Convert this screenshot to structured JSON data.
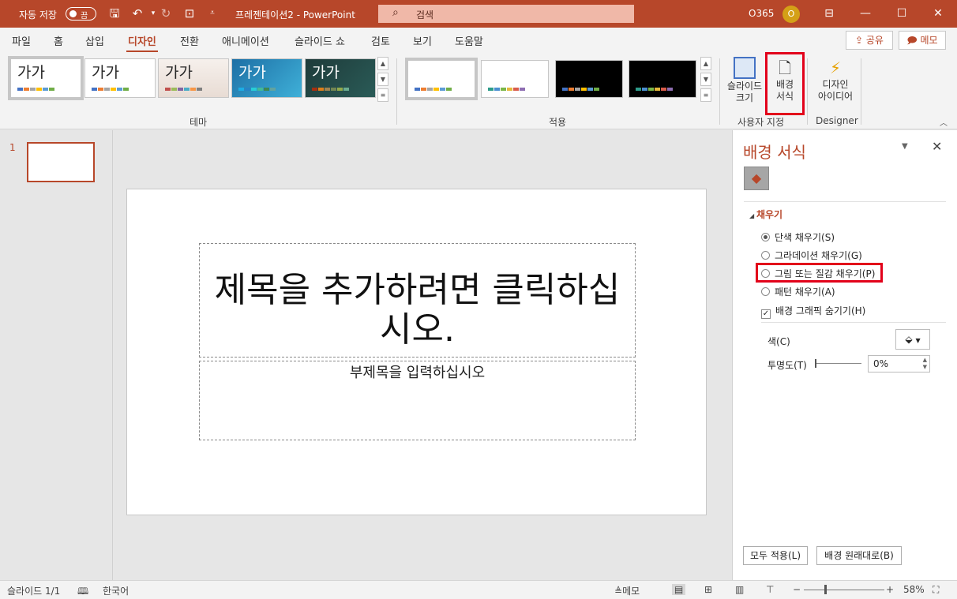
{
  "titlebar": {
    "autosave_label": "자동 저장",
    "autosave_state": "끔",
    "doc_title": "프레젠테이션2 - PowerPoint",
    "search_placeholder": "검색",
    "account": "O365",
    "avatar_initial": "O",
    "accent_color": "#b7472a"
  },
  "ribbon_tabs": [
    "파일",
    "홈",
    "삽입",
    "디자인",
    "전환",
    "애니메이션",
    "슬라이드 쇼",
    "검토",
    "보기",
    "도움말"
  ],
  "active_tab": "디자인",
  "share_label": "공유",
  "memo_label": "메모",
  "themes": {
    "sample_text": "가가",
    "group_label": "테마"
  },
  "variants": {
    "group_label": "적용"
  },
  "custom_group": {
    "slide_size": "슬라이드 크기",
    "format_background_line1": "배경",
    "format_background_line2": "서식",
    "label": "사용자 지정"
  },
  "designer_group": {
    "design_ideas_line1": "디자인",
    "design_ideas_line2": "아이디어",
    "label": "Designer"
  },
  "thumbs": {
    "slide_number": "1"
  },
  "slide": {
    "title_placeholder": "제목을 추가하려면 클릭하십시오.",
    "subtitle_placeholder": "부제목을 입력하십시오"
  },
  "pane": {
    "title": "배경 서식",
    "section_fill": "채우기",
    "options": [
      "단색 채우기(S)",
      "그라데이션 채우기(G)",
      "그림 또는 질감 채우기(P)",
      "패턴 채우기(A)"
    ],
    "selected_option": "단색 채우기(S)",
    "hide_background_graphics": "배경 그래픽 숨기기(H)",
    "hide_background_graphics_checked": true,
    "color_label": "색(C)",
    "transparency_label": "투명도(T)",
    "transparency_value": "0%",
    "apply_all": "모두 적용(L)",
    "reset_background": "배경 원래대로(B)"
  },
  "statusbar": {
    "slide_counter": "슬라이드 1/1",
    "language": "한국어",
    "notes": "메모",
    "zoom": "58%"
  }
}
